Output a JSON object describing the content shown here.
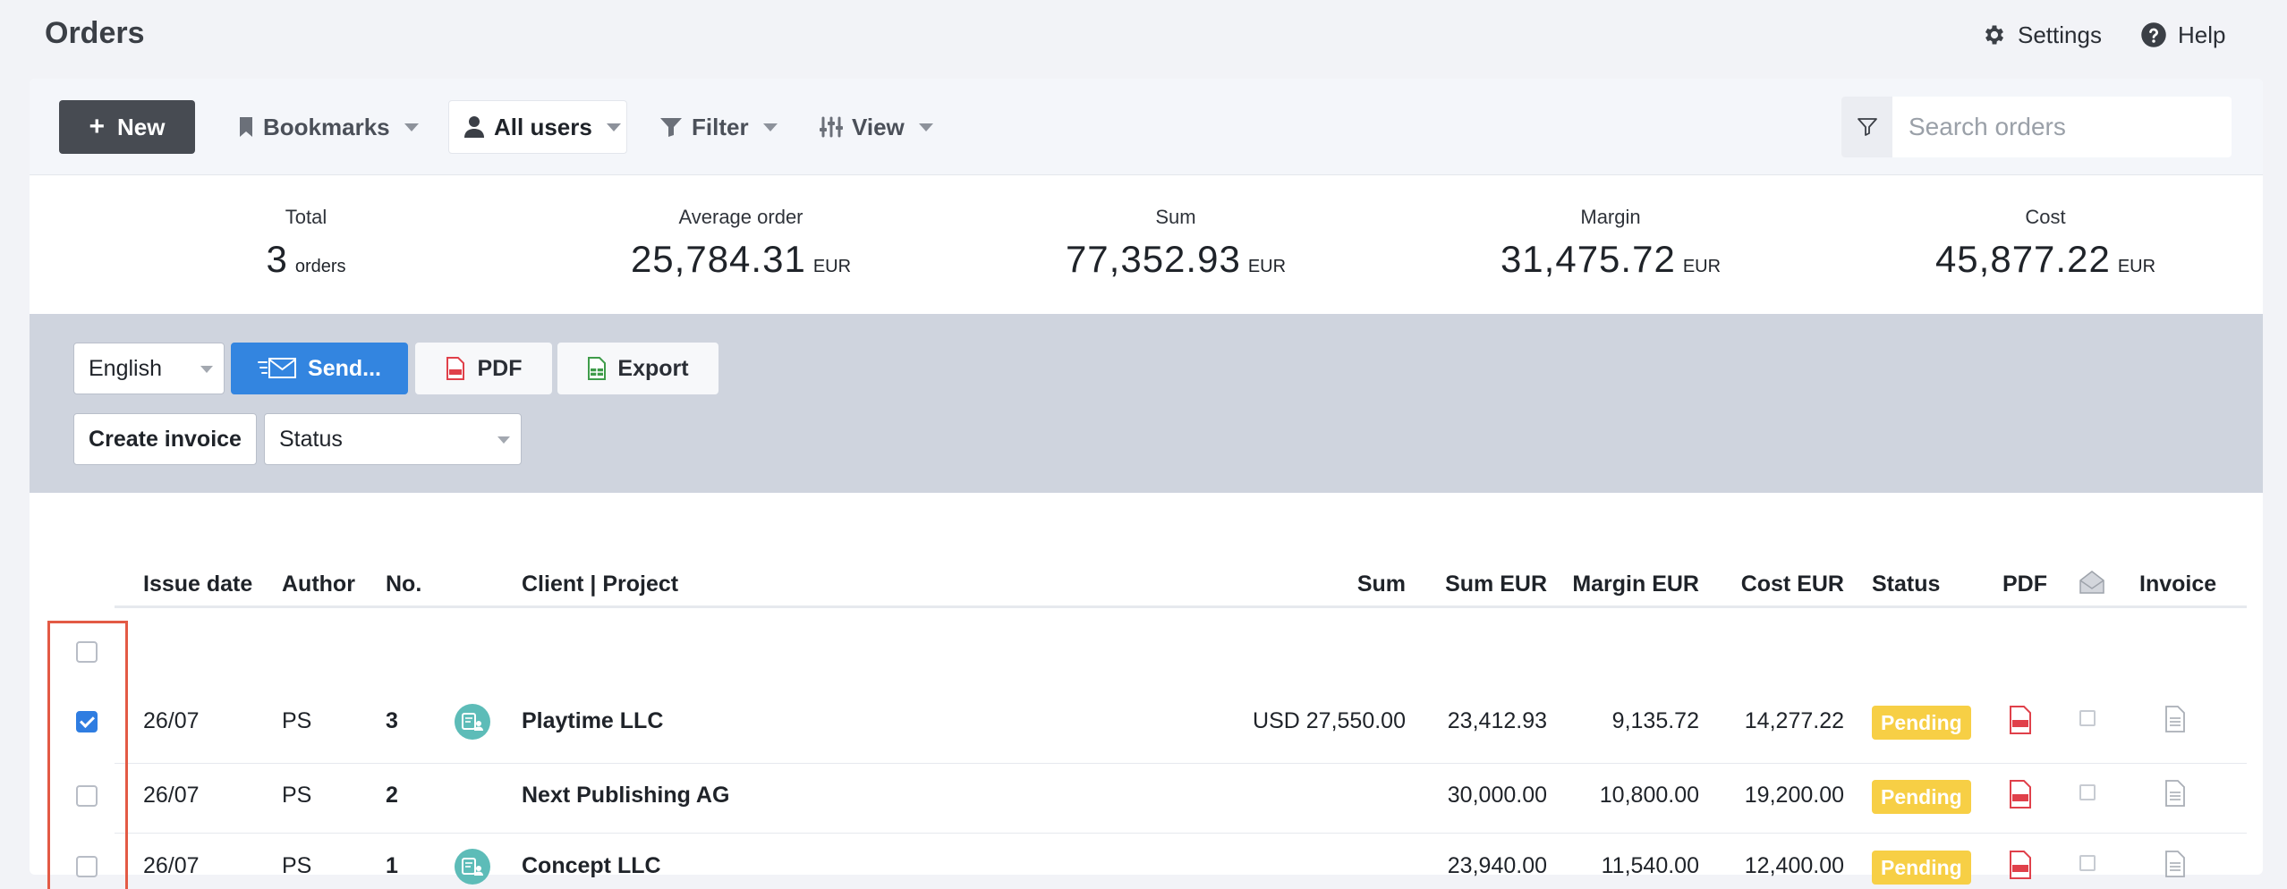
{
  "header": {
    "title": "Orders",
    "settings_label": "Settings",
    "help_label": "Help"
  },
  "toolbar": {
    "new_label": "New",
    "bookmarks_label": "Bookmarks",
    "all_users_label": "All users",
    "filter_label": "Filter",
    "view_label": "View",
    "search_placeholder": "Search orders"
  },
  "stats": {
    "total": {
      "label": "Total",
      "value": "3",
      "unit": "orders"
    },
    "average": {
      "label": "Average order",
      "value": "25,784.31",
      "unit": "EUR"
    },
    "sum": {
      "label": "Sum",
      "value": "77,352.93",
      "unit": "EUR"
    },
    "margin": {
      "label": "Margin",
      "value": "31,475.72",
      "unit": "EUR"
    },
    "cost": {
      "label": "Cost",
      "value": "45,877.22",
      "unit": "EUR"
    }
  },
  "actions": {
    "language": "English",
    "send_label": "Send...",
    "pdf_label": "PDF",
    "export_label": "Export",
    "create_invoice_label": "Create invoice",
    "status_select": "Status"
  },
  "table": {
    "columns": {
      "issue_date": "Issue date",
      "author": "Author",
      "no": "No.",
      "client_project": "Client | Project",
      "sum": "Sum",
      "sum_eur": "Sum EUR",
      "margin_eur": "Margin EUR",
      "cost_eur": "Cost EUR",
      "status": "Status",
      "pdf": "PDF",
      "invoice": "Invoice"
    },
    "rows": [
      {
        "checked": true,
        "issue_date": "26/07",
        "author": "PS",
        "no": "3",
        "has_client_icon": true,
        "client": "Playtime LLC",
        "sum": "USD 27,550.00",
        "sum_eur": "23,412.93",
        "margin_eur": "9,135.72",
        "cost_eur": "14,277.22",
        "status": "Pending"
      },
      {
        "checked": false,
        "issue_date": "26/07",
        "author": "PS",
        "no": "2",
        "has_client_icon": false,
        "client": "Next Publishing AG",
        "sum": "",
        "sum_eur": "30,000.00",
        "margin_eur": "10,800.00",
        "cost_eur": "19,200.00",
        "status": "Pending"
      },
      {
        "checked": false,
        "issue_date": "26/07",
        "author": "PS",
        "no": "1",
        "has_client_icon": true,
        "client": "Concept LLC",
        "sum": "",
        "sum_eur": "23,940.00",
        "margin_eur": "11,540.00",
        "cost_eur": "12,400.00",
        "status": "Pending"
      }
    ]
  },
  "colors": {
    "accent_blue": "#3385e0",
    "pending_badge": "#f7cf45",
    "pdf_red": "#e0404a",
    "highlight_red": "#e35a45",
    "client_icon_teal": "#5dbcb8"
  },
  "icons": {
    "settings": "gear-icon",
    "help": "question-circle-icon",
    "bookmarks": "bookmark-icon",
    "all_users": "user-icon",
    "filter": "funnel-icon",
    "view": "sliders-icon",
    "search": "funnel-outline-icon",
    "send": "envelope-icon",
    "pdf": "pdf-file-icon",
    "export": "spreadsheet-file-icon",
    "mail_column": "open-envelope-icon",
    "invoice": "document-icon"
  }
}
